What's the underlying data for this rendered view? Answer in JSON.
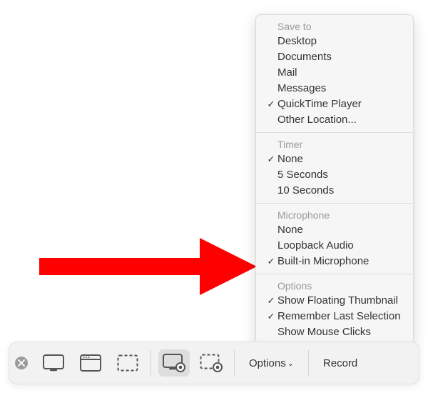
{
  "menu": {
    "save_to": {
      "header": "Save to",
      "items": [
        {
          "label": "Desktop",
          "checked": false
        },
        {
          "label": "Documents",
          "checked": false
        },
        {
          "label": "Mail",
          "checked": false
        },
        {
          "label": "Messages",
          "checked": false
        },
        {
          "label": "QuickTime Player",
          "checked": true
        },
        {
          "label": "Other Location...",
          "checked": false
        }
      ]
    },
    "timer": {
      "header": "Timer",
      "items": [
        {
          "label": "None",
          "checked": true
        },
        {
          "label": "5 Seconds",
          "checked": false
        },
        {
          "label": "10 Seconds",
          "checked": false
        }
      ]
    },
    "microphone": {
      "header": "Microphone",
      "items": [
        {
          "label": "None",
          "checked": false
        },
        {
          "label": "Loopback Audio",
          "checked": false
        },
        {
          "label": "Built-in Microphone",
          "checked": true
        }
      ]
    },
    "options": {
      "header": "Options",
      "items": [
        {
          "label": "Show Floating Thumbnail",
          "checked": true
        },
        {
          "label": "Remember Last Selection",
          "checked": true
        },
        {
          "label": "Show Mouse Clicks",
          "checked": false
        }
      ]
    }
  },
  "toolbar": {
    "options_label": "Options",
    "record_label": "Record"
  },
  "glyphs": {
    "check": "✓",
    "caret": "⌄"
  },
  "colors": {
    "arrow": "#ff0000"
  }
}
